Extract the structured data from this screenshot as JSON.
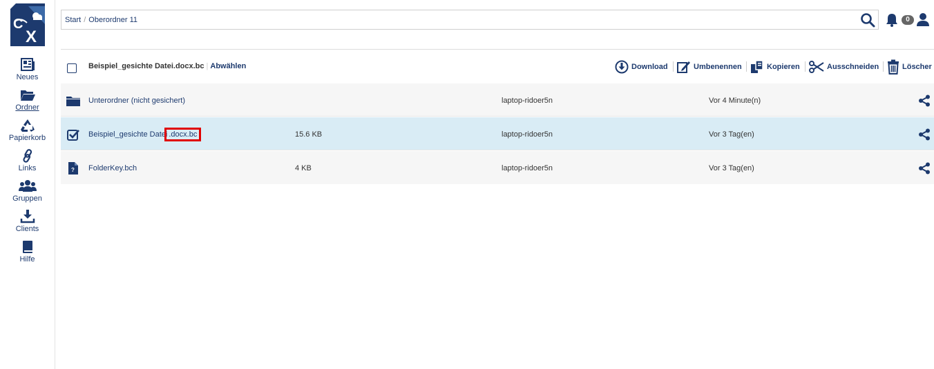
{
  "sidebar": {
    "items": [
      {
        "label": "Neues",
        "icon": "news-icon"
      },
      {
        "label": "Ordner",
        "icon": "folder-open-icon",
        "active": true
      },
      {
        "label": "Papierkorb",
        "icon": "recycle-icon"
      },
      {
        "label": "Links",
        "icon": "link-icon"
      },
      {
        "label": "Gruppen",
        "icon": "group-icon"
      },
      {
        "label": "Clients",
        "icon": "download-icon"
      },
      {
        "label": "Hilfe",
        "icon": "book-icon"
      }
    ]
  },
  "header": {
    "breadcrumb": [
      "Start",
      "Oberordner 11"
    ],
    "notification_count": "0"
  },
  "toolbar": {
    "selected_name": "Beispiel_gesichte Datei.docx.bc",
    "deselect_label": "Abwählen",
    "actions": [
      "Download",
      "Umbenennen",
      "Kopieren",
      "Ausschneiden",
      "Löscher"
    ]
  },
  "files": [
    {
      "name": "Unterordner (nicht gesichert)",
      "size": "",
      "owner": "laptop-ridoer5n",
      "modified": "Vor 4 Minute(n)",
      "type": "folder"
    },
    {
      "name_main": "Beispiel_gesichte Datei",
      "name_ext": ".docx.bc",
      "size": "15.6 KB",
      "owner": "laptop-ridoer5n",
      "modified": "Vor 3 Tag(en)",
      "type": "file",
      "selected": true
    },
    {
      "name": "FolderKey.bch",
      "size": "4 KB",
      "owner": "laptop-ridoer5n",
      "modified": "Vor 3 Tag(en)",
      "type": "file"
    }
  ],
  "colors": {
    "brand": "#1d3a6e",
    "selected_row": "#d9ecf5",
    "highlight": "#e00000"
  }
}
